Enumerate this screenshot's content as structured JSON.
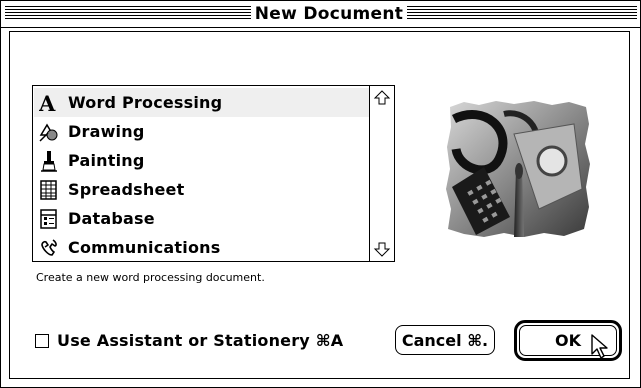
{
  "window": {
    "title": "New Document"
  },
  "list": {
    "items": [
      {
        "label": "Word Processing",
        "icon": "letter-a-icon",
        "selected": true
      },
      {
        "label": "Drawing",
        "icon": "drawing-shapes-icon",
        "selected": false
      },
      {
        "label": "Painting",
        "icon": "paintbrush-icon",
        "selected": false
      },
      {
        "label": "Spreadsheet",
        "icon": "spreadsheet-grid-icon",
        "selected": false
      },
      {
        "label": "Database",
        "icon": "database-form-icon",
        "selected": false
      },
      {
        "label": "Communications",
        "icon": "telephone-handset-icon",
        "selected": false
      }
    ]
  },
  "description": "Create a new word processing document.",
  "checkbox": {
    "label": "Use Assistant or Stationery ⌘A",
    "checked": false
  },
  "buttons": {
    "cancel_label": "Cancel ⌘.",
    "ok_label": "OK",
    "default": "OK"
  },
  "colors": {
    "selection": "#efefef",
    "frame": "#000000",
    "background": "#ffffff"
  }
}
